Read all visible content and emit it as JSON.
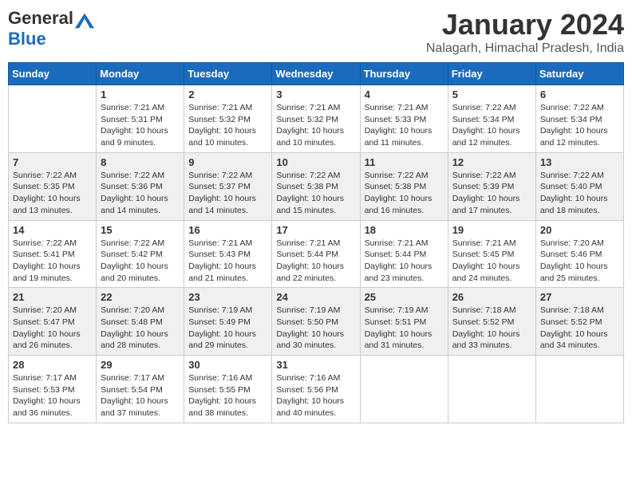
{
  "header": {
    "logo_general": "General",
    "logo_blue": "Blue",
    "month_title": "January 2024",
    "subtitle": "Nalagarh, Himachal Pradesh, India"
  },
  "weekdays": [
    "Sunday",
    "Monday",
    "Tuesday",
    "Wednesday",
    "Thursday",
    "Friday",
    "Saturday"
  ],
  "weeks": [
    [
      {
        "day": "",
        "sunrise": "",
        "sunset": "",
        "daylight": ""
      },
      {
        "day": "1",
        "sunrise": "Sunrise: 7:21 AM",
        "sunset": "Sunset: 5:31 PM",
        "daylight": "Daylight: 10 hours and 9 minutes."
      },
      {
        "day": "2",
        "sunrise": "Sunrise: 7:21 AM",
        "sunset": "Sunset: 5:32 PM",
        "daylight": "Daylight: 10 hours and 10 minutes."
      },
      {
        "day": "3",
        "sunrise": "Sunrise: 7:21 AM",
        "sunset": "Sunset: 5:32 PM",
        "daylight": "Daylight: 10 hours and 10 minutes."
      },
      {
        "day": "4",
        "sunrise": "Sunrise: 7:21 AM",
        "sunset": "Sunset: 5:33 PM",
        "daylight": "Daylight: 10 hours and 11 minutes."
      },
      {
        "day": "5",
        "sunrise": "Sunrise: 7:22 AM",
        "sunset": "Sunset: 5:34 PM",
        "daylight": "Daylight: 10 hours and 12 minutes."
      },
      {
        "day": "6",
        "sunrise": "Sunrise: 7:22 AM",
        "sunset": "Sunset: 5:34 PM",
        "daylight": "Daylight: 10 hours and 12 minutes."
      }
    ],
    [
      {
        "day": "7",
        "sunrise": "Sunrise: 7:22 AM",
        "sunset": "Sunset: 5:35 PM",
        "daylight": "Daylight: 10 hours and 13 minutes."
      },
      {
        "day": "8",
        "sunrise": "Sunrise: 7:22 AM",
        "sunset": "Sunset: 5:36 PM",
        "daylight": "Daylight: 10 hours and 14 minutes."
      },
      {
        "day": "9",
        "sunrise": "Sunrise: 7:22 AM",
        "sunset": "Sunset: 5:37 PM",
        "daylight": "Daylight: 10 hours and 14 minutes."
      },
      {
        "day": "10",
        "sunrise": "Sunrise: 7:22 AM",
        "sunset": "Sunset: 5:38 PM",
        "daylight": "Daylight: 10 hours and 15 minutes."
      },
      {
        "day": "11",
        "sunrise": "Sunrise: 7:22 AM",
        "sunset": "Sunset: 5:38 PM",
        "daylight": "Daylight: 10 hours and 16 minutes."
      },
      {
        "day": "12",
        "sunrise": "Sunrise: 7:22 AM",
        "sunset": "Sunset: 5:39 PM",
        "daylight": "Daylight: 10 hours and 17 minutes."
      },
      {
        "day": "13",
        "sunrise": "Sunrise: 7:22 AM",
        "sunset": "Sunset: 5:40 PM",
        "daylight": "Daylight: 10 hours and 18 minutes."
      }
    ],
    [
      {
        "day": "14",
        "sunrise": "Sunrise: 7:22 AM",
        "sunset": "Sunset: 5:41 PM",
        "daylight": "Daylight: 10 hours and 19 minutes."
      },
      {
        "day": "15",
        "sunrise": "Sunrise: 7:22 AM",
        "sunset": "Sunset: 5:42 PM",
        "daylight": "Daylight: 10 hours and 20 minutes."
      },
      {
        "day": "16",
        "sunrise": "Sunrise: 7:21 AM",
        "sunset": "Sunset: 5:43 PM",
        "daylight": "Daylight: 10 hours and 21 minutes."
      },
      {
        "day": "17",
        "sunrise": "Sunrise: 7:21 AM",
        "sunset": "Sunset: 5:44 PM",
        "daylight": "Daylight: 10 hours and 22 minutes."
      },
      {
        "day": "18",
        "sunrise": "Sunrise: 7:21 AM",
        "sunset": "Sunset: 5:44 PM",
        "daylight": "Daylight: 10 hours and 23 minutes."
      },
      {
        "day": "19",
        "sunrise": "Sunrise: 7:21 AM",
        "sunset": "Sunset: 5:45 PM",
        "daylight": "Daylight: 10 hours and 24 minutes."
      },
      {
        "day": "20",
        "sunrise": "Sunrise: 7:20 AM",
        "sunset": "Sunset: 5:46 PM",
        "daylight": "Daylight: 10 hours and 25 minutes."
      }
    ],
    [
      {
        "day": "21",
        "sunrise": "Sunrise: 7:20 AM",
        "sunset": "Sunset: 5:47 PM",
        "daylight": "Daylight: 10 hours and 26 minutes."
      },
      {
        "day": "22",
        "sunrise": "Sunrise: 7:20 AM",
        "sunset": "Sunset: 5:48 PM",
        "daylight": "Daylight: 10 hours and 28 minutes."
      },
      {
        "day": "23",
        "sunrise": "Sunrise: 7:19 AM",
        "sunset": "Sunset: 5:49 PM",
        "daylight": "Daylight: 10 hours and 29 minutes."
      },
      {
        "day": "24",
        "sunrise": "Sunrise: 7:19 AM",
        "sunset": "Sunset: 5:50 PM",
        "daylight": "Daylight: 10 hours and 30 minutes."
      },
      {
        "day": "25",
        "sunrise": "Sunrise: 7:19 AM",
        "sunset": "Sunset: 5:51 PM",
        "daylight": "Daylight: 10 hours and 31 minutes."
      },
      {
        "day": "26",
        "sunrise": "Sunrise: 7:18 AM",
        "sunset": "Sunset: 5:52 PM",
        "daylight": "Daylight: 10 hours and 33 minutes."
      },
      {
        "day": "27",
        "sunrise": "Sunrise: 7:18 AM",
        "sunset": "Sunset: 5:52 PM",
        "daylight": "Daylight: 10 hours and 34 minutes."
      }
    ],
    [
      {
        "day": "28",
        "sunrise": "Sunrise: 7:17 AM",
        "sunset": "Sunset: 5:53 PM",
        "daylight": "Daylight: 10 hours and 36 minutes."
      },
      {
        "day": "29",
        "sunrise": "Sunrise: 7:17 AM",
        "sunset": "Sunset: 5:54 PM",
        "daylight": "Daylight: 10 hours and 37 minutes."
      },
      {
        "day": "30",
        "sunrise": "Sunrise: 7:16 AM",
        "sunset": "Sunset: 5:55 PM",
        "daylight": "Daylight: 10 hours and 38 minutes."
      },
      {
        "day": "31",
        "sunrise": "Sunrise: 7:16 AM",
        "sunset": "Sunset: 5:56 PM",
        "daylight": "Daylight: 10 hours and 40 minutes."
      },
      {
        "day": "",
        "sunrise": "",
        "sunset": "",
        "daylight": ""
      },
      {
        "day": "",
        "sunrise": "",
        "sunset": "",
        "daylight": ""
      },
      {
        "day": "",
        "sunrise": "",
        "sunset": "",
        "daylight": ""
      }
    ]
  ]
}
